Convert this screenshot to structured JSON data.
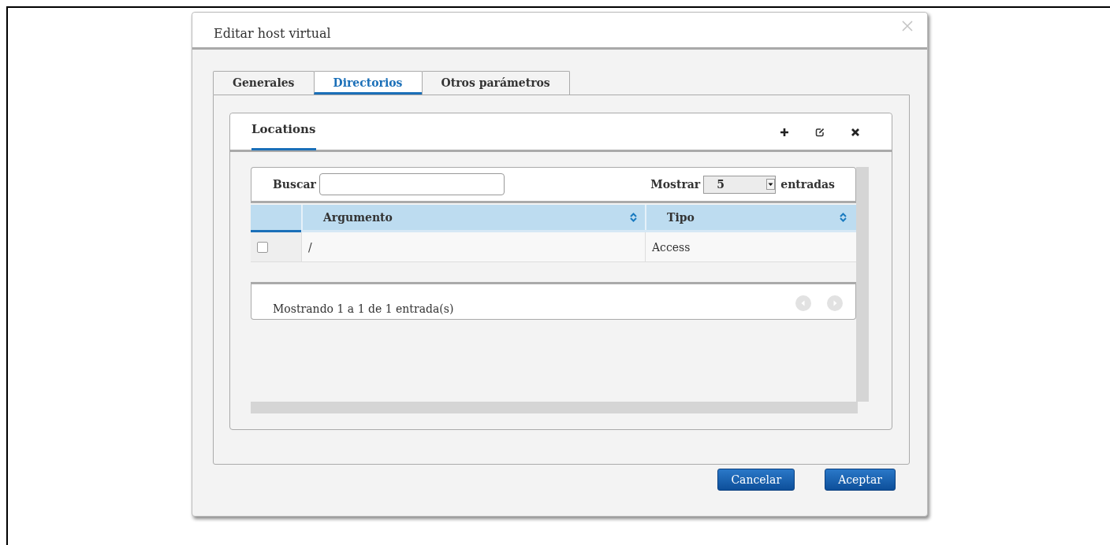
{
  "dialog": {
    "title": "Editar host virtual"
  },
  "tabs": [
    {
      "label": "Generales",
      "selected": false
    },
    {
      "label": "Directorios",
      "selected": true
    },
    {
      "label": "Otros parámetros",
      "selected": false
    }
  ],
  "panel": {
    "title": "Locations",
    "actions": [
      {
        "kind": "add"
      },
      {
        "kind": "edit"
      },
      {
        "kind": "delete"
      }
    ]
  },
  "table": {
    "search_label": "Buscar",
    "show_label": "Mostrar",
    "page_size": "5",
    "entries_label": "entradas",
    "columns": [
      {
        "label": "Argumento"
      },
      {
        "label": "Tipo"
      }
    ],
    "rows": [
      {
        "checked": false,
        "cells": [
          "/",
          "Access"
        ]
      }
    ],
    "info": "Mostrando 1 a 1 de 1 entrada(s)"
  },
  "buttons": [
    "Cancelar",
    "Aceptar"
  ]
}
